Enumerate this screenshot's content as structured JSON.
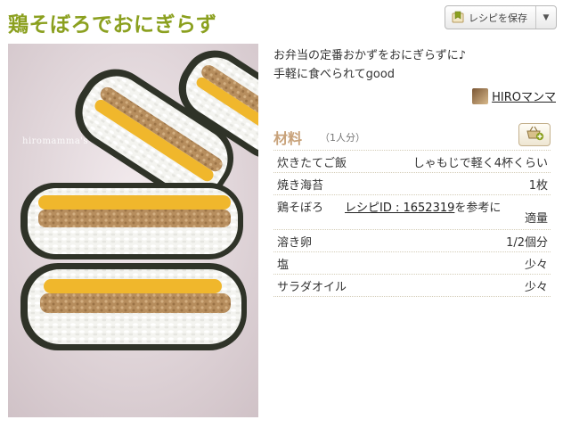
{
  "recipe": {
    "title": "鶏そぼろでおにぎらず",
    "description_lines": [
      "お弁当の定番おかずをおにぎらずに♪",
      "手軽に食べられてgood"
    ],
    "author": "HIROマンマ",
    "photo_watermark": "hiromamma's"
  },
  "toolbar": {
    "save_label": "レシピを保存",
    "save_icon": "bookmark-icon",
    "menu_icon": "chevron-down-icon"
  },
  "ingredients": {
    "title": "材料",
    "servings": "（1人分）",
    "basket_icon": "basket-add-icon",
    "items": [
      {
        "name": "炊きたてご飯",
        "amount": "しゃもじで軽く4杯くらい"
      },
      {
        "name": "焼き海苔",
        "amount": "1枚"
      },
      {
        "name": "鶏そぼろ",
        "ref_link": "レシピID : 1652319",
        "ref_suffix": "を参考に",
        "amount": "適量"
      },
      {
        "name": "溶き卵",
        "amount": "1/2個分"
      },
      {
        "name": "塩",
        "amount": "少々"
      },
      {
        "name": "サラダオイル",
        "amount": "少々"
      }
    ]
  },
  "colors": {
    "title": "#8ba01f",
    "ingredients_title": "#c8a27a",
    "photo_background": "#d9ccd1"
  }
}
